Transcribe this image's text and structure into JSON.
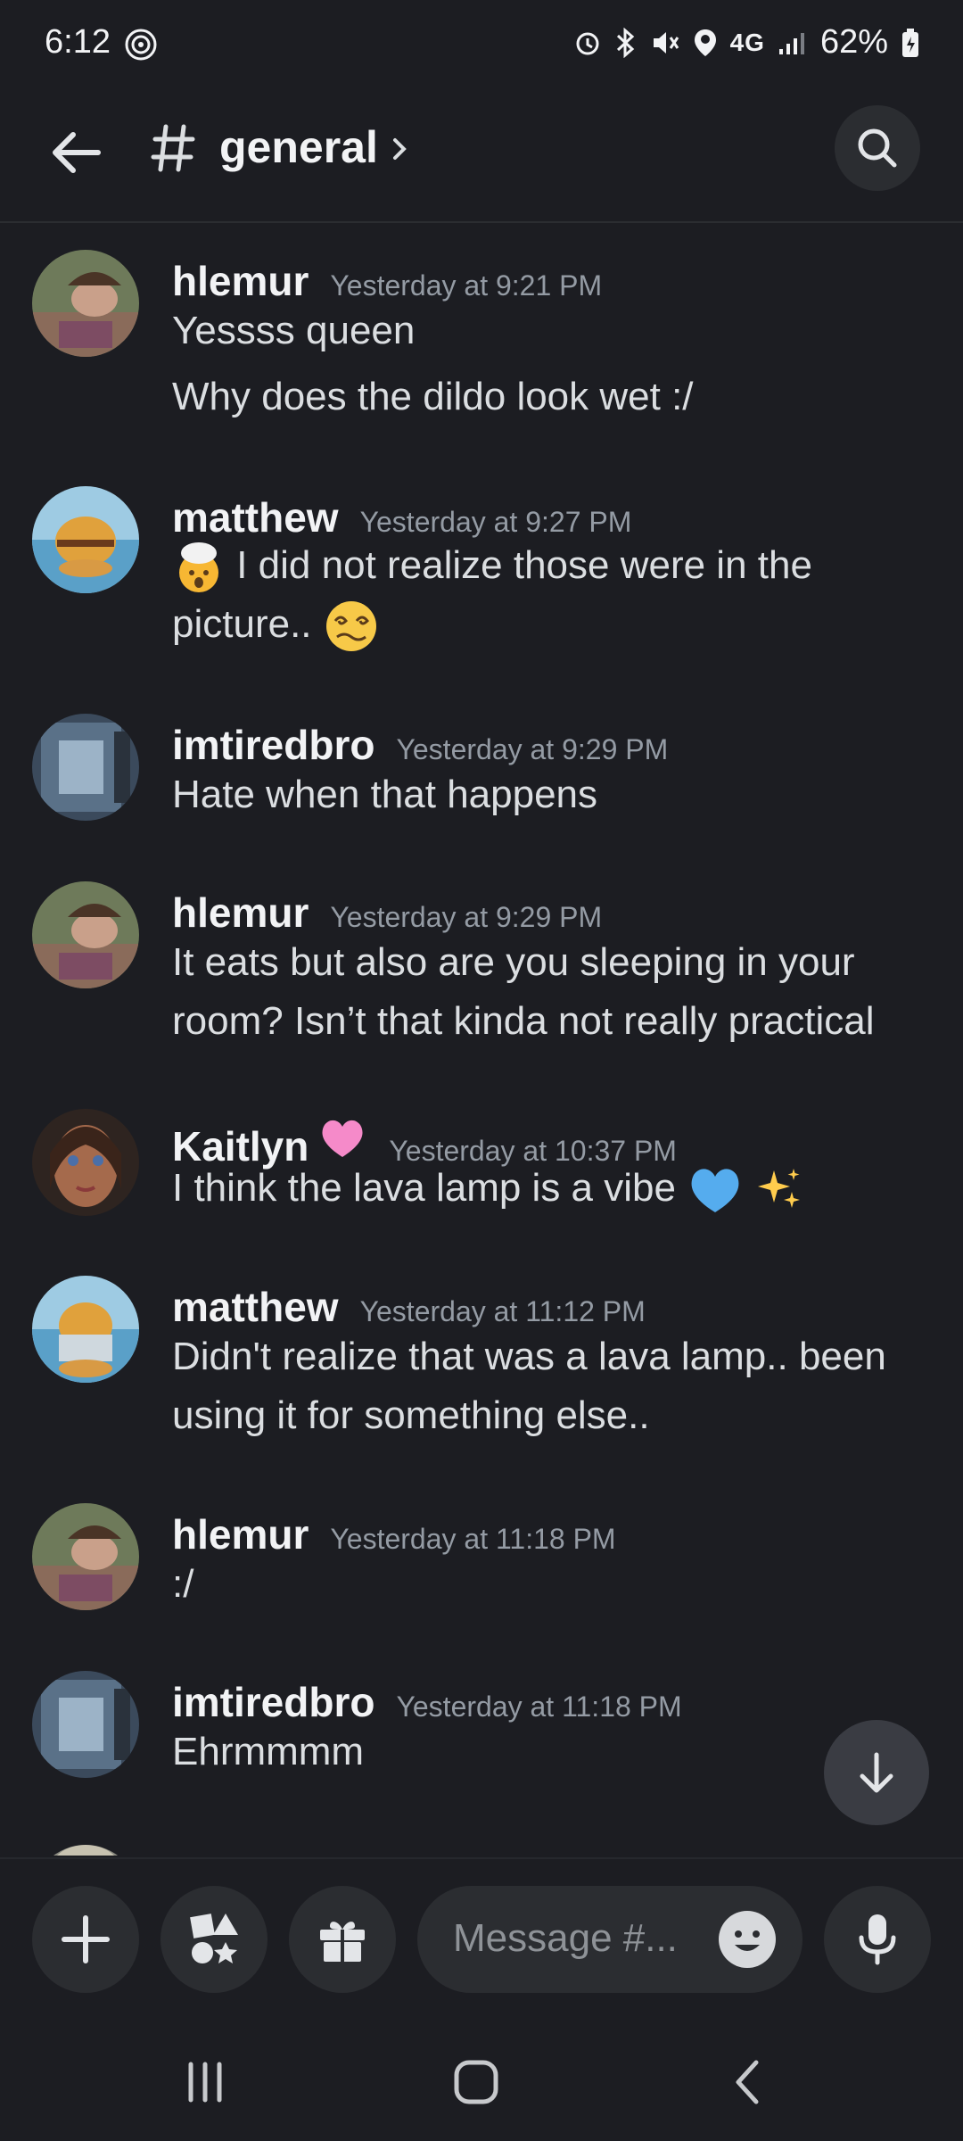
{
  "status_bar": {
    "time": "6:12",
    "network": "4G",
    "battery": "62%"
  },
  "header": {
    "channel_symbol": "#",
    "channel_name": "general"
  },
  "messages": [
    {
      "user": "hlemur",
      "time": "Yesterday at 9:21 PM",
      "lines": [
        "Yessss queen",
        "Why does the dildo look wet :/"
      ]
    },
    {
      "user": "matthew",
      "time": "Yesterday at 9:27 PM",
      "lines": [
        "I did not realize those were in the",
        "picture.."
      ]
    },
    {
      "user": "imtiredbro",
      "time": "Yesterday at 9:29 PM",
      "lines": [
        "Hate when that happens"
      ]
    },
    {
      "user": "hlemur",
      "time": "Yesterday at 9:29 PM",
      "lines": [
        "It eats but also are you sleeping in your",
        "room? Isn’t that kinda not really practical"
      ]
    },
    {
      "user": "Kaitlyn",
      "time": "Yesterday at 10:37 PM",
      "lines": [
        "I think the lava lamp is a vibe"
      ]
    },
    {
      "user": "matthew",
      "time": "Yesterday at 11:12 PM",
      "lines": [
        "Didn't realize that was a lava lamp.. been",
        "using it for something else.."
      ]
    },
    {
      "user": "hlemur",
      "time": "Yesterday at 11:18 PM",
      "lines": [
        ":/"
      ]
    },
    {
      "user": "imtiredbro",
      "time": "Yesterday at 11:18 PM",
      "lines": [
        "Ehrmmmm"
      ]
    }
  ],
  "composer": {
    "placeholder": "Message #..."
  },
  "colors": {
    "background": "#1c1d22",
    "surface": "#2b2d31",
    "text_primary": "#f2f3f5",
    "text_muted": "#949ba4"
  },
  "icons": [
    "back-arrow-icon",
    "hash-icon",
    "chevron-right-icon",
    "search-icon",
    "arrow-down-icon",
    "plus-icon",
    "apps-icon",
    "gift-icon",
    "emoji-icon",
    "microphone-icon",
    "recents-icon",
    "home-icon",
    "back-nav-icon"
  ]
}
